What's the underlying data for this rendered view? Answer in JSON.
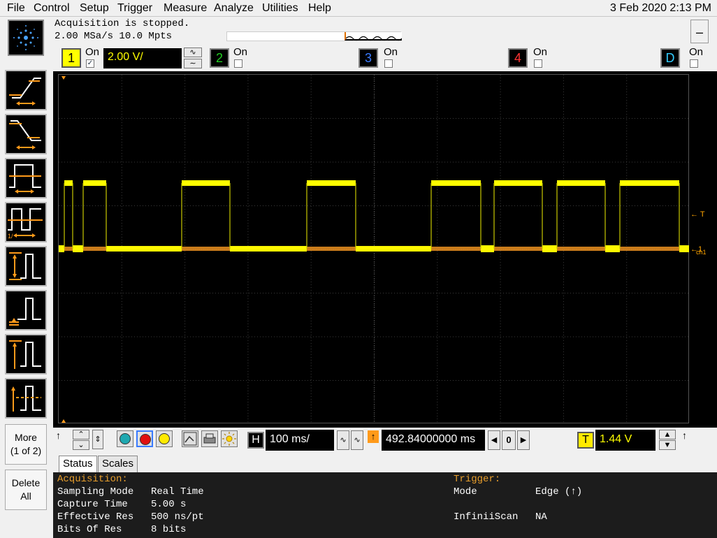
{
  "menu": {
    "items": [
      "File",
      "Control",
      "Setup",
      "Trigger",
      "Measure",
      "Analyze",
      "Utilities",
      "Help"
    ],
    "datetime": "3 Feb 2020  2:13 PM"
  },
  "acquisition_bar": {
    "state": "Acquisition is stopped.",
    "rate": "2.00 MSa/s   10.0 Mpts",
    "minimize_symbol": "–"
  },
  "channels": [
    {
      "number": "1",
      "on_label": "On",
      "checked": true,
      "scale": "2.00 V/",
      "color": "#ffff00"
    },
    {
      "number": "2",
      "on_label": "On",
      "checked": false,
      "color": "#22cc22"
    },
    {
      "number": "3",
      "on_label": "On",
      "checked": false,
      "color": "#3a7bff"
    },
    {
      "number": "4",
      "on_label": "On",
      "checked": false,
      "color": "#ff3333"
    },
    {
      "number": "D",
      "on_label": "On",
      "checked": false,
      "color": "#33ccff"
    }
  ],
  "sidebar": {
    "more_label_1": "More",
    "more_label_2": "(1 of 2)",
    "delete_label_1": "Delete",
    "delete_label_2": "All"
  },
  "markers": {
    "trigger_marker": "← T",
    "channel_marker": "←1",
    "ref_label": "ch1"
  },
  "controls": {
    "timebase": "100 ms/",
    "delay": "492.84000000 ms",
    "delay_counter": "0",
    "trigger_box": "T",
    "trigger_level": "1.44 V",
    "h_box": "H"
  },
  "tabs": [
    "Status",
    "Scales"
  ],
  "status": {
    "acquisition_header": "Acquisition:",
    "rows": [
      {
        "key": "Sampling Mode",
        "value": "Real Time"
      },
      {
        "key": "Capture Time",
        "value": "5.00 s"
      },
      {
        "key": "Effective Res",
        "value": "500 ns/pt"
      },
      {
        "key": "Bits Of Res",
        "value": "8 bits"
      }
    ],
    "trigger_header": "Trigger:",
    "trigger_rows": [
      {
        "key": "Mode",
        "value": "Edge (↑)"
      },
      {
        "key": "InfiniiScan",
        "value": "NA"
      }
    ]
  },
  "colors": {
    "trace": "#ffff00",
    "reference": "#e08a1e",
    "accent": "#e89e2c"
  }
}
